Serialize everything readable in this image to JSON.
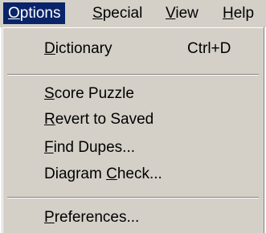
{
  "menubar": {
    "items": [
      {
        "mnemonic": "O",
        "rest": "ptions"
      },
      {
        "mnemonic": "S",
        "rest": "pecial"
      },
      {
        "mnemonic": "V",
        "rest": "iew"
      },
      {
        "mnemonic": "H",
        "rest": "elp"
      }
    ]
  },
  "options_menu": {
    "dictionary": {
      "mnemonic": "D",
      "rest": "ictionary",
      "shortcut": "Ctrl+D"
    },
    "score_puzzle": {
      "mnemonic": "S",
      "rest": "core Puzzle"
    },
    "revert_to_saved": {
      "mnemonic": "R",
      "rest": "evert to Saved"
    },
    "find_dupes": {
      "mnemonic": "F",
      "rest": "ind Dupes..."
    },
    "diagram_check": {
      "before": "Diagram ",
      "mnemonic": "C",
      "rest": "heck..."
    },
    "preferences": {
      "mnemonic": "P",
      "rest": "references..."
    }
  }
}
